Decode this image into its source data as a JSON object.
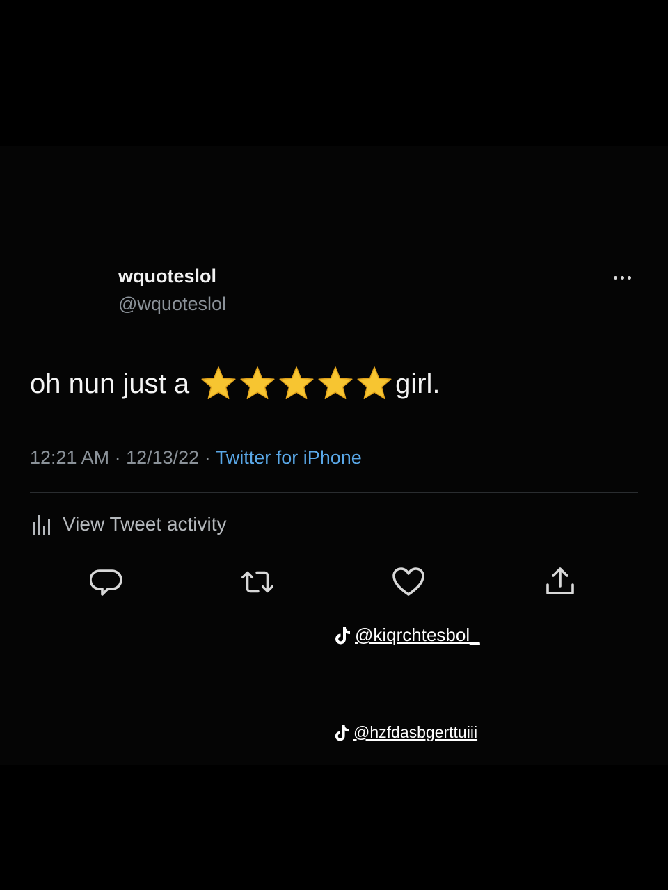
{
  "tweet": {
    "display_name": "wquoteslol",
    "handle": "@wquoteslol",
    "text_before": "oh nun just a",
    "star_count": 5,
    "text_after": "girl.",
    "time": "12:21 AM",
    "date": "12/13/22",
    "separator": " · ",
    "source": "Twitter for iPhone"
  },
  "activity": {
    "label": "View Tweet activity",
    "icon": "analytics-bars-icon"
  },
  "actions": [
    {
      "name": "reply-button",
      "icon": "reply-bubble-icon"
    },
    {
      "name": "retweet-button",
      "icon": "retweet-arrows-icon"
    },
    {
      "name": "like-button",
      "icon": "heart-icon"
    },
    {
      "name": "share-button",
      "icon": "share-upload-icon"
    }
  ],
  "watermarks": {
    "top": "@kiqrchtesbol_",
    "bottom": "@hzfdasbgerttuiii"
  },
  "colors": {
    "background": "#000000",
    "text": "#f4f4f4",
    "muted": "#8b9299",
    "link": "#5aa8e8",
    "star": "#f7c531"
  }
}
